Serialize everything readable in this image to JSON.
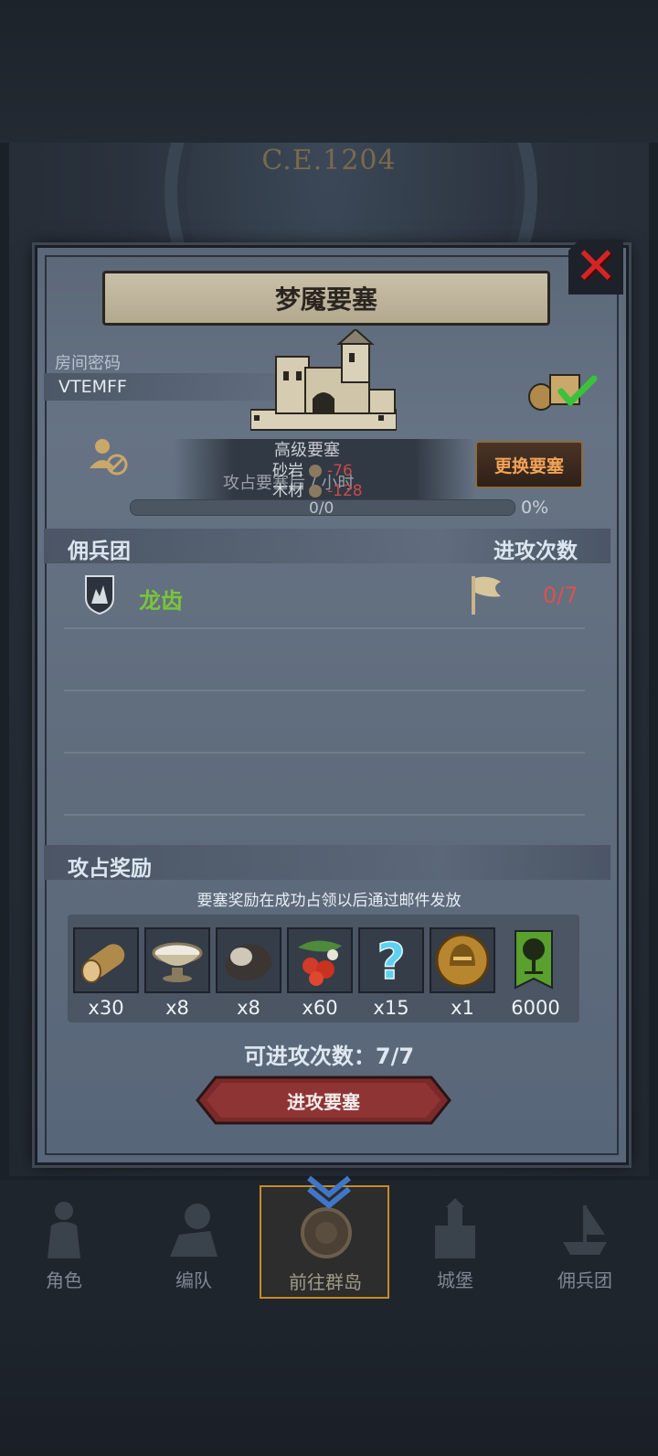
{
  "background": {
    "era": "C.E.1204"
  },
  "dialog": {
    "title": "梦魇要塞",
    "room_code_label": "房间密码",
    "room_code": "VTEMFF",
    "fortress_level": "高级要塞",
    "occupy_hint": "攻占要塞后 / 小时",
    "resources": [
      {
        "name": "砂岩",
        "value": "-76"
      },
      {
        "name": "木材",
        "value": "-128"
      }
    ],
    "change_button": "更换要塞",
    "progress": {
      "count": "0/0",
      "percent": "0%",
      "fraction": 0
    },
    "mercenary_header": "佣兵团",
    "attack_count_header": "进攻次数",
    "mercenary": {
      "name": "龙齿",
      "attacks": "0/7"
    },
    "reward_header": "攻占奖励",
    "reward_note": "要塞奖励在成功占领以后通过邮件发放",
    "rewards": [
      {
        "icon": "wood-log-icon",
        "qty": "x30"
      },
      {
        "icon": "bowl-icon",
        "qty": "x8"
      },
      {
        "icon": "ore-icon",
        "qty": "x8"
      },
      {
        "icon": "berries-icon",
        "qty": "x60"
      },
      {
        "icon": "mystery-question-icon",
        "qty": "x15"
      },
      {
        "icon": "knight-helmet-icon",
        "qty": "x1"
      },
      {
        "icon": "tree-banner-icon",
        "qty": "6000"
      }
    ],
    "available_attacks": "可进攻次数：7/7",
    "attack_button": "进攻要塞"
  },
  "nav": [
    {
      "label": "角色",
      "icon": "knight-icon"
    },
    {
      "label": "编队",
      "icon": "cavalry-icon"
    },
    {
      "label": "前往群岛",
      "icon": "compass-icon",
      "active": true
    },
    {
      "label": "城堡",
      "icon": "castle-icon"
    },
    {
      "label": "佣兵团",
      "icon": "ship-icon"
    }
  ],
  "colors": {
    "accent_orange": "#f3a356",
    "mercenary_green": "#7ac43a",
    "attack_count_red": "#d9534f",
    "close_red": "#d42424",
    "nav_active_border": "#c98a28"
  }
}
